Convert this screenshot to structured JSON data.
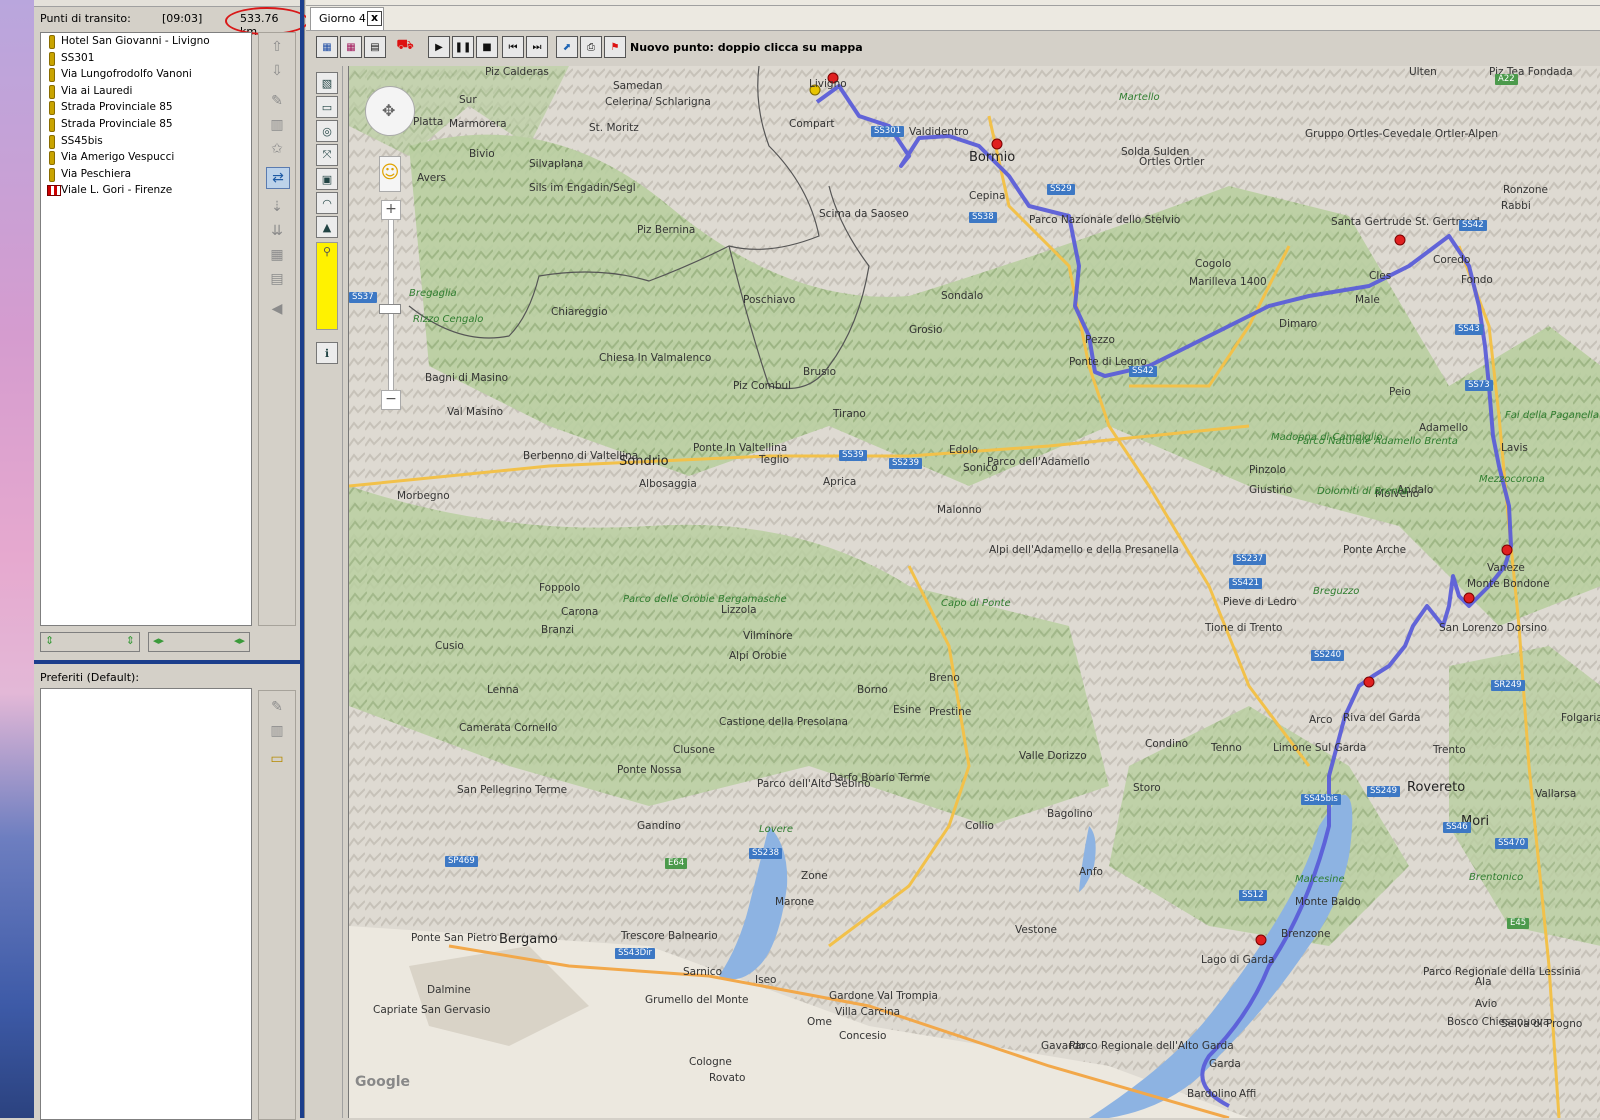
{
  "waypoints": {
    "title": "Punti di transito:",
    "time": "[09:03]",
    "distance": "533.76 km.",
    "items": [
      "Hotel San Giovanni - Livigno",
      "SS301",
      "Via Lungofrodolfo Vanoni",
      "Via ai Lauredi",
      "Strada Provinciale 85",
      "Strada Provinciale 85",
      "SS45bis",
      "Via Amerigo Vespucci",
      "Via Peschiera",
      "Viale L. Gori - Firenze"
    ]
  },
  "favorites": {
    "title": "Preferiti (Default):"
  },
  "tab": {
    "label": "Giorno 4",
    "close": "x"
  },
  "toolbar": {
    "hint": "Nuovo punto: doppio clicca su mappa"
  },
  "map": {
    "copyright": "Google",
    "places": [
      {
        "t": "Livigno"
      },
      {
        "t": "Compart"
      },
      {
        "t": "Valdidentro"
      },
      {
        "t": "Bormio"
      },
      {
        "t": "Cepina"
      },
      {
        "t": "Piz Calderas"
      },
      {
        "t": "Samedan"
      },
      {
        "t": "Celerina/ Schlarigna"
      },
      {
        "t": "St. Moritz"
      },
      {
        "t": "Sur"
      },
      {
        "t": "Platta"
      },
      {
        "t": "Marmorera"
      },
      {
        "t": "Bivio"
      },
      {
        "t": "Silvaplana"
      },
      {
        "t": "Avers"
      },
      {
        "t": "Sils im Engadin/Segl"
      },
      {
        "t": "Piz Bernina"
      },
      {
        "t": "Scima da Saoseo"
      },
      {
        "t": "Parco Nazionale dello Stelvio"
      },
      {
        "t": "Bregaglia"
      },
      {
        "t": "Chiareggio"
      },
      {
        "t": "Poschiavo"
      },
      {
        "t": "Sondalo"
      },
      {
        "t": "Grosio"
      },
      {
        "t": "Pezzo"
      },
      {
        "t": "Ponte di Legno"
      },
      {
        "t": "Rizzo Cengalo"
      },
      {
        "t": "Chiesa In Valmalenco"
      },
      {
        "t": "Piz Combul"
      },
      {
        "t": "Brusio"
      },
      {
        "t": "Bagni di Masino"
      },
      {
        "t": "Val Masino"
      },
      {
        "t": "Tirano"
      },
      {
        "t": "Sondrio"
      },
      {
        "t": "Berbenno di Valtellina"
      },
      {
        "t": "Ponte In Valtellina"
      },
      {
        "t": "Teglio"
      },
      {
        "t": "Aprica"
      },
      {
        "t": "Edolo"
      },
      {
        "t": "Sonico"
      },
      {
        "t": "Albosaggia"
      },
      {
        "t": "Morbegno"
      },
      {
        "t": "Malonno"
      },
      {
        "t": "Foppolo"
      },
      {
        "t": "Carona"
      },
      {
        "t": "Branzi"
      },
      {
        "t": "Parco delle Orobie Bergamasche"
      },
      {
        "t": "Lizzola"
      },
      {
        "t": "Vilminore"
      },
      {
        "t": "Alpi Orobie"
      },
      {
        "t": "Capo di Ponte"
      },
      {
        "t": "Cusio"
      },
      {
        "t": "Lenna"
      },
      {
        "t": "Camerata Cornello"
      },
      {
        "t": "Borno"
      },
      {
        "t": "Breno"
      },
      {
        "t": "Esine"
      },
      {
        "t": "Prestine"
      },
      {
        "t": "Castione della Presolana"
      },
      {
        "t": "Clusone"
      },
      {
        "t": "Darfo Boario Terme"
      },
      {
        "t": "Ponte Nossa"
      },
      {
        "t": "San Pellegrino Terme"
      },
      {
        "t": "Gandino"
      },
      {
        "t": "Lovere"
      },
      {
        "t": "Parco dell'Alto Sebino"
      },
      {
        "t": "Zone"
      },
      {
        "t": "Marone"
      },
      {
        "t": "Ponte San Pietro"
      },
      {
        "t": "Bergamo"
      },
      {
        "t": "Trescore Balneario"
      },
      {
        "t": "Dalmine"
      },
      {
        "t": "Sarnico"
      },
      {
        "t": "Iseo"
      },
      {
        "t": "Capriate San Gervasio"
      },
      {
        "t": "Grumello del Monte"
      },
      {
        "t": "Ome"
      },
      {
        "t": "Gardone Val Trompia"
      },
      {
        "t": "Villa Carcina"
      },
      {
        "t": "Concesio"
      },
      {
        "t": "Cologne"
      },
      {
        "t": "Rovato"
      },
      {
        "t": "Collio"
      },
      {
        "t": "Bagolino"
      },
      {
        "t": "Storo"
      },
      {
        "t": "Condino"
      },
      {
        "t": "Valle Dorizzo"
      },
      {
        "t": "Anfo"
      },
      {
        "t": "Vestone"
      },
      {
        "t": "Gavardo"
      },
      {
        "t": "Parco Regionale dell'Alto Garda"
      },
      {
        "t": "Bardolino"
      },
      {
        "t": "Affi"
      },
      {
        "t": "Garda"
      },
      {
        "t": "Brenzone"
      },
      {
        "t": "Lago di Garda"
      },
      {
        "t": "Malcesine"
      },
      {
        "t": "Monte Baldo"
      },
      {
        "t": "Limone Sul Garda"
      },
      {
        "t": "Riva del Garda"
      },
      {
        "t": "Arco"
      },
      {
        "t": "Tenno"
      },
      {
        "t": "Pieve di Ledro"
      },
      {
        "t": "Tione di Trento"
      },
      {
        "t": "Breguzzo"
      },
      {
        "t": "Ponte Arche"
      },
      {
        "t": "San Lorenzo Dorsino"
      },
      {
        "t": "Monte Bondone"
      },
      {
        "t": "Vaneze"
      },
      {
        "t": "Trento"
      },
      {
        "t": "Rovereto"
      },
      {
        "t": "Mori"
      },
      {
        "t": "Brentonico"
      },
      {
        "t": "Ala"
      },
      {
        "t": "Avio"
      },
      {
        "t": "Vallarsa"
      },
      {
        "t": "Folgaria"
      },
      {
        "t": "Parco Regionale della Lessinia"
      },
      {
        "t": "Bosco Chiesanuova"
      },
      {
        "t": "Selva di Progno"
      },
      {
        "t": "Pinzolo"
      },
      {
        "t": "Giustino"
      },
      {
        "t": "Molveno"
      },
      {
        "t": "Andalo"
      },
      {
        "t": "Fai della Paganella"
      },
      {
        "t": "Lavis"
      },
      {
        "t": "Mezzocorona"
      },
      {
        "t": "Dolomiti di Brenta"
      },
      {
        "t": "Madonna di Campiglio"
      },
      {
        "t": "Parco Naturale Adamello Brenta"
      },
      {
        "t": "Adamello"
      },
      {
        "t": "Parco dell'Adamello"
      },
      {
        "t": "Alpi dell'Adamello e della Presanella"
      },
      {
        "t": "Peio"
      },
      {
        "t": "Cogolo"
      },
      {
        "t": "Marilleva 1400"
      },
      {
        "t": "Dimaro"
      },
      {
        "t": "Male"
      },
      {
        "t": "Cles"
      },
      {
        "t": "Coredo"
      },
      {
        "t": "Fondo"
      },
      {
        "t": "Ronzone"
      },
      {
        "t": "Rabbi"
      },
      {
        "t": "Santa Gertrude St. Gertraud"
      },
      {
        "t": "Gruppo Ortles-Cevedale Ortler-Alpen"
      },
      {
        "t": "Solda Sulden"
      },
      {
        "t": "Ortles Ortler"
      },
      {
        "t": "Martello"
      },
      {
        "t": "Ulten"
      },
      {
        "t": "Piz Tea Fondada"
      }
    ],
    "roads": [
      "SS301",
      "SS38",
      "SS29",
      "SS42",
      "SS43",
      "SS73",
      "SS39",
      "SS239",
      "SS237",
      "SS421",
      "SS240",
      "SS249",
      "SS45bis",
      "SS12",
      "SS46",
      "SS470",
      "SP469",
      "E64",
      "SS43Dir",
      "SS238",
      "SS42",
      "A22",
      "E45",
      "SR249",
      "SS37"
    ]
  },
  "colors": {
    "route": "#5b5ed8",
    "pin": "#e02020",
    "selected_bg": "#1b3e8c"
  }
}
